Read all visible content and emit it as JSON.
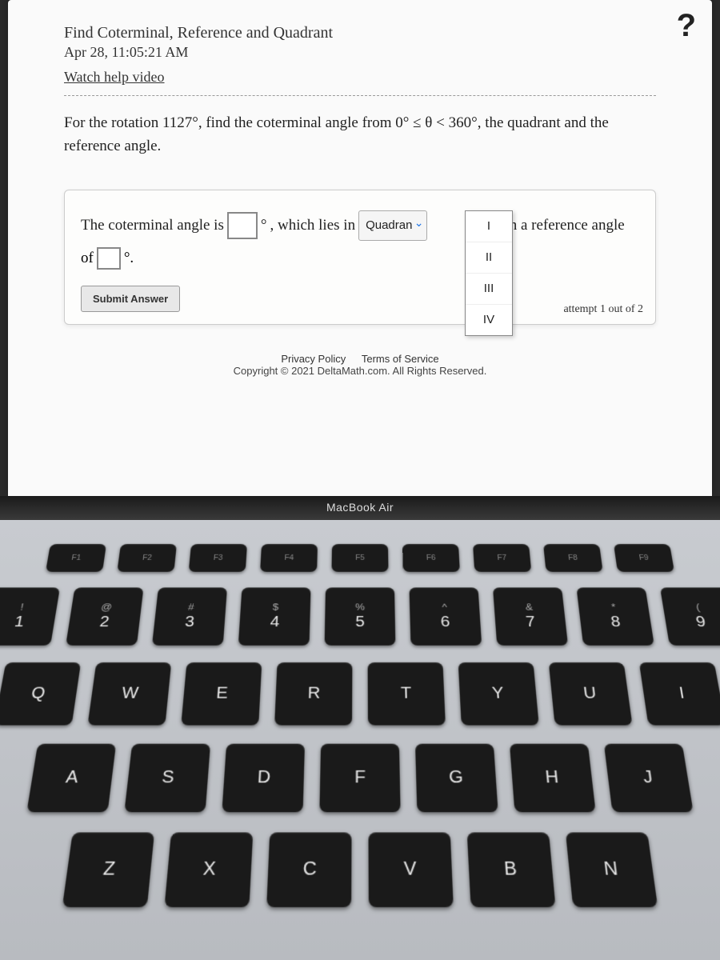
{
  "header": {
    "title": "Find Coterminal, Reference and Quadrant",
    "date": "Apr 28, 11:05:21 AM",
    "video_link": "Watch help video",
    "help_icon": "?"
  },
  "question": {
    "text_prefix": "For the rotation ",
    "angle": "1127°",
    "text_mid": ", find the coterminal angle from ",
    "range": "0° ≤ θ < 360°",
    "text_suffix": ", the quadrant and the reference angle."
  },
  "answer": {
    "line1_a": "The coterminal angle is",
    "deg": "°",
    "line1_b": ", which lies in",
    "quadrant_label": "Quadran",
    "line1_c": "with a reference angle",
    "of": "of",
    "period": "°.",
    "options": [
      "I",
      "II",
      "III",
      "IV"
    ],
    "submit": "Submit Answer",
    "attempts": "attempt 1 out of 2"
  },
  "footer": {
    "privacy": "Privacy Policy",
    "terms": "Terms of Service",
    "copyright": "Copyright © 2021 DeltaMath.com. All Rights Reserved."
  },
  "device": {
    "label": "MacBook Air"
  },
  "keyboard": {
    "fn_row": [
      "F1",
      "F2",
      "F3",
      "F4",
      "F5",
      "F6",
      "F7",
      "F8",
      "F9"
    ],
    "num_row": [
      {
        "u": "!",
        "l": "1"
      },
      {
        "u": "@",
        "l": "2"
      },
      {
        "u": "#",
        "l": "3"
      },
      {
        "u": "$",
        "l": "4"
      },
      {
        "u": "%",
        "l": "5"
      },
      {
        "u": "^",
        "l": "6"
      },
      {
        "u": "&",
        "l": "7"
      },
      {
        "u": "*",
        "l": "8"
      },
      {
        "u": "(",
        "l": "9"
      }
    ],
    "row_q": [
      "Q",
      "W",
      "E",
      "R",
      "T",
      "Y",
      "U",
      "I"
    ],
    "row_a": [
      "A",
      "S",
      "D",
      "F",
      "G",
      "H",
      "J"
    ],
    "row_z": [
      "Z",
      "X",
      "C",
      "V",
      "B",
      "N"
    ]
  }
}
